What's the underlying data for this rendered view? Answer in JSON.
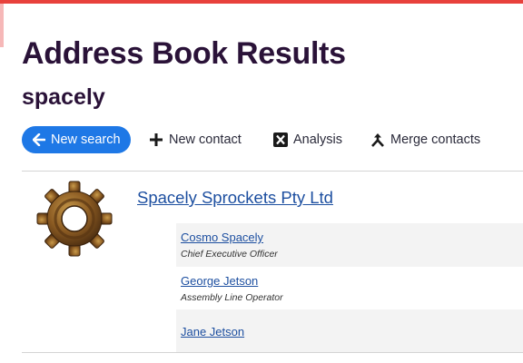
{
  "header": {
    "title": "Address Book Results",
    "query": "spacely"
  },
  "toolbar": {
    "new_search": "New search",
    "new_contact": "New contact",
    "analysis": "Analysis",
    "merge_contacts": "Merge contacts"
  },
  "colors": {
    "accent_red": "#e8413c",
    "button_blue": "#1e78e6",
    "link_blue": "#1d4fa0",
    "title_purple": "#2a1238"
  },
  "icons": {
    "new_search": "arrow-left-icon",
    "new_contact": "plus-icon",
    "analysis": "excel-icon",
    "merge_contacts": "merge-icon",
    "logo": "gear-logo"
  },
  "results": [
    {
      "organisation": "Spacely Sprockets Pty Ltd",
      "contacts": [
        {
          "name": "Cosmo Spacely",
          "role": "Chief Executive Officer"
        },
        {
          "name": "George Jetson",
          "role": "Assembly Line Operator"
        },
        {
          "name": "Jane Jetson",
          "role": ""
        }
      ]
    }
  ]
}
